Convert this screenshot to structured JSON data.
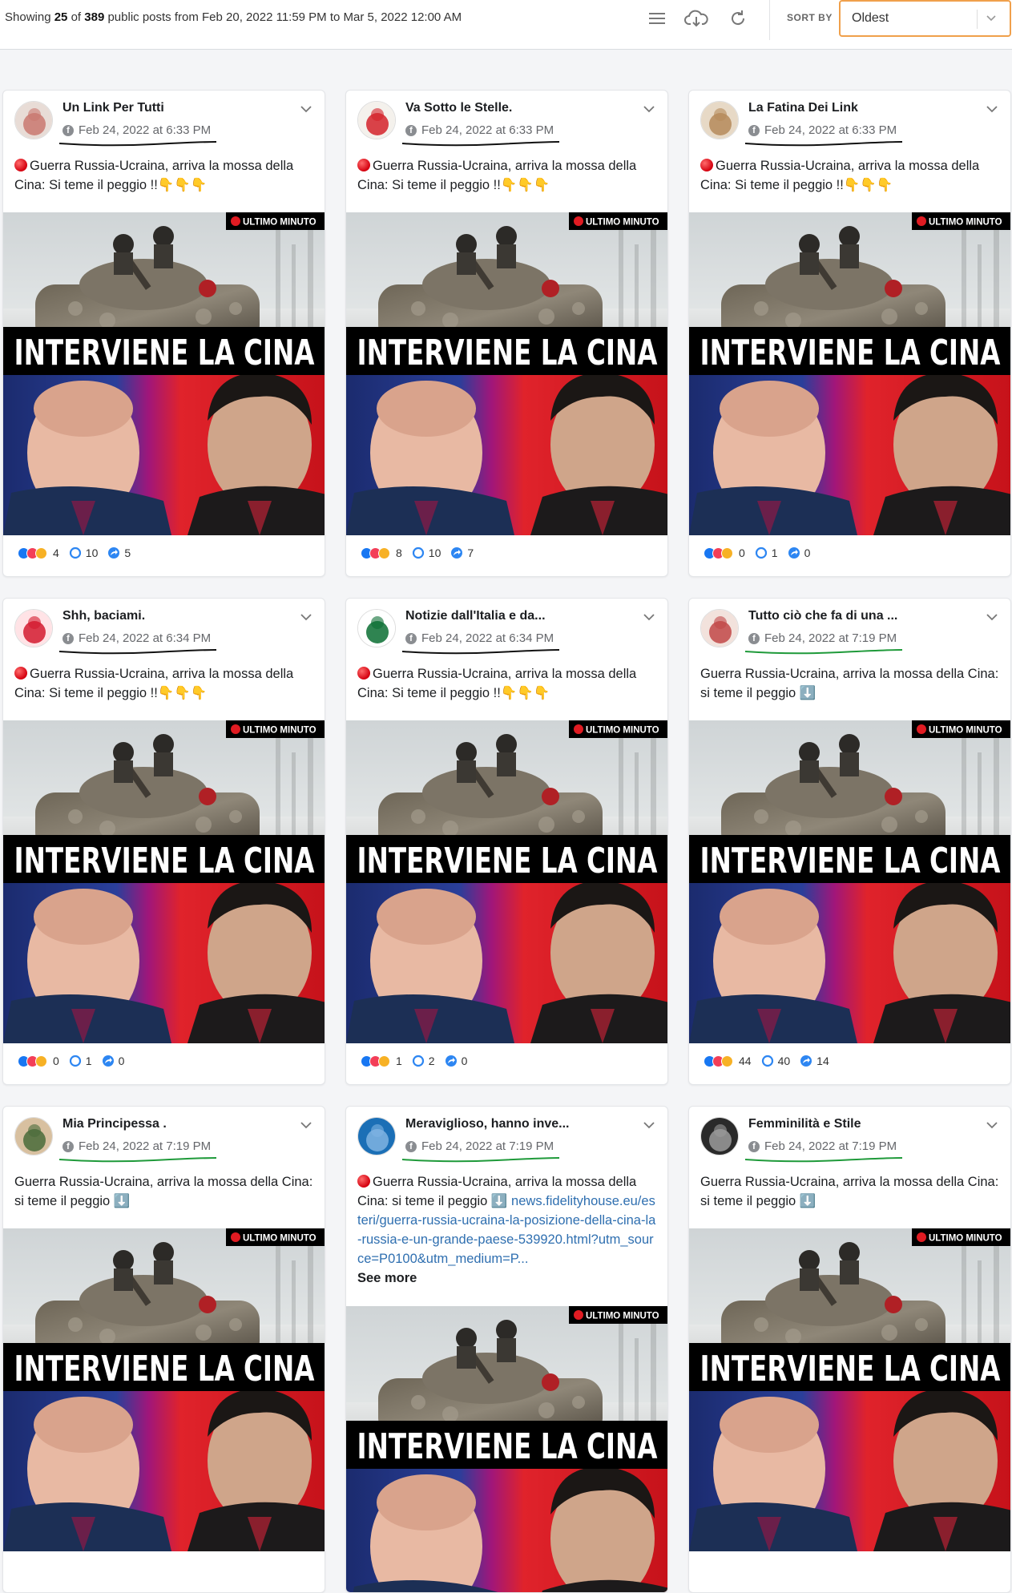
{
  "header": {
    "summary_prefix": "Showing",
    "shown_count": "25",
    "of_text": "of",
    "total_count": "389",
    "summary_suffix": "public posts from Feb 20, 2022 11:59 PM to Mar 5, 2022 12:00 AM",
    "sort_label": "SORT BY",
    "sort_value": "Oldest",
    "icons": [
      "list-icon",
      "cloud-download-icon",
      "refresh-icon",
      "chevron-down-icon"
    ]
  },
  "image": {
    "badge": "ULTIMO MINUTO",
    "headline": "INTERVIENE LA CINA"
  },
  "posts": [
    {
      "author": "Un Link Per Tutti",
      "date": "Feb 24, 2022 at 6:33 PM",
      "text": "Guerra Russia-Ucraina, arriva la mossa della Cina: Si teme il peggio !!👇👇👇",
      "red_dot": true,
      "reactions": "4",
      "comments": "10",
      "shares": "5",
      "mark_color": "#111111"
    },
    {
      "author": "Va Sotto le Stelle.",
      "date": "Feb 24, 2022 at 6:33 PM",
      "text": "Guerra Russia-Ucraina, arriva la mossa della Cina: Si teme il peggio !!👇👇👇",
      "red_dot": true,
      "reactions": "8",
      "comments": "10",
      "shares": "7",
      "mark_color": "#111111"
    },
    {
      "author": "La Fatina Dei Link",
      "date": "Feb 24, 2022 at 6:33 PM",
      "text": "Guerra Russia-Ucraina, arriva la mossa della Cina: Si teme il peggio !!👇👇👇",
      "red_dot": true,
      "reactions": "0",
      "comments": "1",
      "shares": "0",
      "mark_color": "#111111"
    },
    {
      "author": "Shh, baciami.",
      "date": "Feb 24, 2022 at 6:34 PM",
      "text": "Guerra Russia-Ucraina, arriva la mossa della Cina: Si teme il peggio !!👇👇👇",
      "red_dot": true,
      "reactions": "0",
      "comments": "1",
      "shares": "0",
      "mark_color": "#111111"
    },
    {
      "author": "Notizie dall'Italia e da...",
      "date": "Feb 24, 2022 at 6:34 PM",
      "text": "Guerra Russia-Ucraina, arriva la mossa della Cina: Si teme il peggio !!👇👇👇",
      "red_dot": true,
      "reactions": "1",
      "comments": "2",
      "shares": "0",
      "mark_color": "#111111"
    },
    {
      "author": "Tutto ciò che fa di una ...",
      "date": "Feb 24, 2022 at 7:19 PM",
      "text": "Guerra Russia-Ucraina, arriva la mossa della Cina: si teme il peggio ⬇️",
      "red_dot": false,
      "reactions": "44",
      "comments": "40",
      "shares": "14",
      "mark_color": "#1f9a3a"
    },
    {
      "author": "Mia Principessa .",
      "date": "Feb 24, 2022 at 7:19 PM",
      "text": "Guerra Russia-Ucraina, arriva la mossa della Cina: si teme il peggio ⬇️",
      "red_dot": false,
      "mark_color": "#1f9a3a"
    },
    {
      "author": "Meraviglioso, hanno inve...",
      "date": "Feb 24, 2022 at 7:19 PM",
      "text": "Guerra Russia-Ucraina, arriva la mossa della Cina: si teme il peggio ⬇️ ",
      "link": "news.fidelityhouse.eu/esteri/guerra-russia-ucraina-la-posizione-della-cina-la-russia-e-un-grande-paese-539920.html?utm_source=P0100&utm_medium=P...",
      "see_more": "See more",
      "red_dot": true,
      "mark_color": "#1f9a3a"
    },
    {
      "author": "Femminilità e Stile",
      "date": "Feb 24, 2022 at 7:19 PM",
      "text": "Guerra Russia-Ucraina, arriva la mossa della Cina: si teme il peggio ⬇️",
      "red_dot": false,
      "mark_color": "#1f9a3a"
    }
  ],
  "colors": {
    "accent": "#f0a04b",
    "link": "#2f6fb0",
    "red_badge": "#d4000f"
  }
}
